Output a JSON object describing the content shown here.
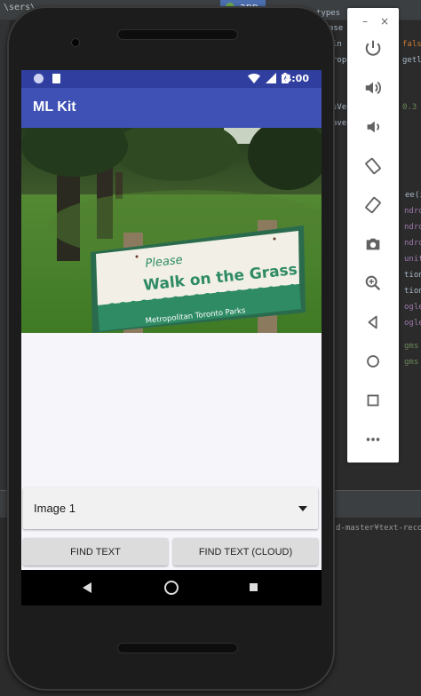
{
  "ide": {
    "path_fragment": "\\sers\\",
    "tab_label": "app",
    "bottom_path": "d-master¥text-reco",
    "code_right": [
      {
        "text": "types",
        "cls": ""
      },
      {
        "text": "ase",
        "cls": ""
      },
      {
        "text": "in",
        "cls": ""
      },
      {
        "text": "rop",
        "cls": ""
      },
      {
        "text": "fals",
        "cls": "orange"
      },
      {
        "text": "getl",
        "cls": ""
      },
      {
        "text": "sVe",
        "cls": ""
      },
      {
        "text": "0.3",
        "cls": "green"
      },
      {
        "text": "ave",
        "cls": ""
      },
      {
        "text": "ee(i",
        "cls": ""
      },
      {
        "text": "ndro",
        "cls": "purple"
      },
      {
        "text": "ndro",
        "cls": "purple"
      },
      {
        "text": "ndro",
        "cls": "purple"
      },
      {
        "text": "unit",
        "cls": "purple"
      },
      {
        "text": "tion",
        "cls": ""
      },
      {
        "text": "tion",
        "cls": ""
      },
      {
        "text": "ogle",
        "cls": "purple"
      },
      {
        "text": "ogle",
        "cls": "purple"
      },
      {
        "text": "gms",
        "cls": "green"
      },
      {
        "text": "gms",
        "cls": "green"
      }
    ]
  },
  "emulator_panel": {
    "close_label": "×",
    "minimize_label": "–",
    "buttons": [
      "power-icon",
      "volume-up-icon",
      "volume-down-icon",
      "rotate-left-icon",
      "rotate-right-icon",
      "camera-icon",
      "zoom-icon",
      "back-icon",
      "home-icon",
      "overview-icon",
      "more-icon"
    ]
  },
  "status_bar": {
    "time": "4:00"
  },
  "app_bar": {
    "title": "ML Kit"
  },
  "photo": {
    "sign_line1": "Please",
    "sign_line2": "Walk on the Grass",
    "sign_line3": "Metropolitan Toronto Parks"
  },
  "spinner": {
    "selected": "Image 1"
  },
  "buttons": {
    "find_text": "FIND TEXT",
    "find_text_cloud": "FIND TEXT (CLOUD)"
  },
  "colors": {
    "status_bar": "#303f9f",
    "app_bar": "#3f51b5",
    "sign_green": "#2e8b64"
  }
}
